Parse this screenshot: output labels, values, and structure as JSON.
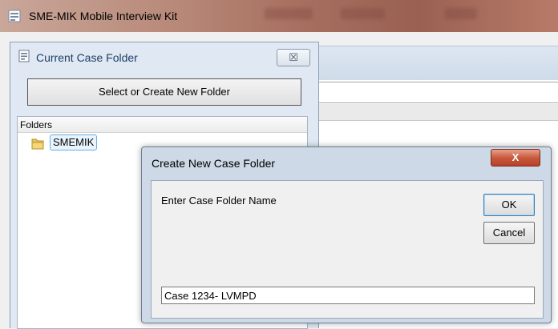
{
  "app": {
    "title": "SME-MIK Mobile Interview Kit"
  },
  "folder_panel": {
    "title": "Current Case Folder",
    "close_symbol": "☒",
    "select_button_label": "Select or Create New Folder",
    "folders_header": "Folders",
    "folders": [
      {
        "label": "SMEMIK",
        "icon": "folder-icon",
        "selected": true
      }
    ]
  },
  "dialog": {
    "title": "Create New Case Folder",
    "close_symbol": "X",
    "prompt": "Enter Case Folder Name",
    "ok_label": "OK",
    "cancel_label": "Cancel",
    "name_value": "Case 1234- LVMPD"
  },
  "colors": {
    "dialog_close": "#c85a3e",
    "selection_border": "#66aee6",
    "panel_title_text": "#1e3f66"
  }
}
